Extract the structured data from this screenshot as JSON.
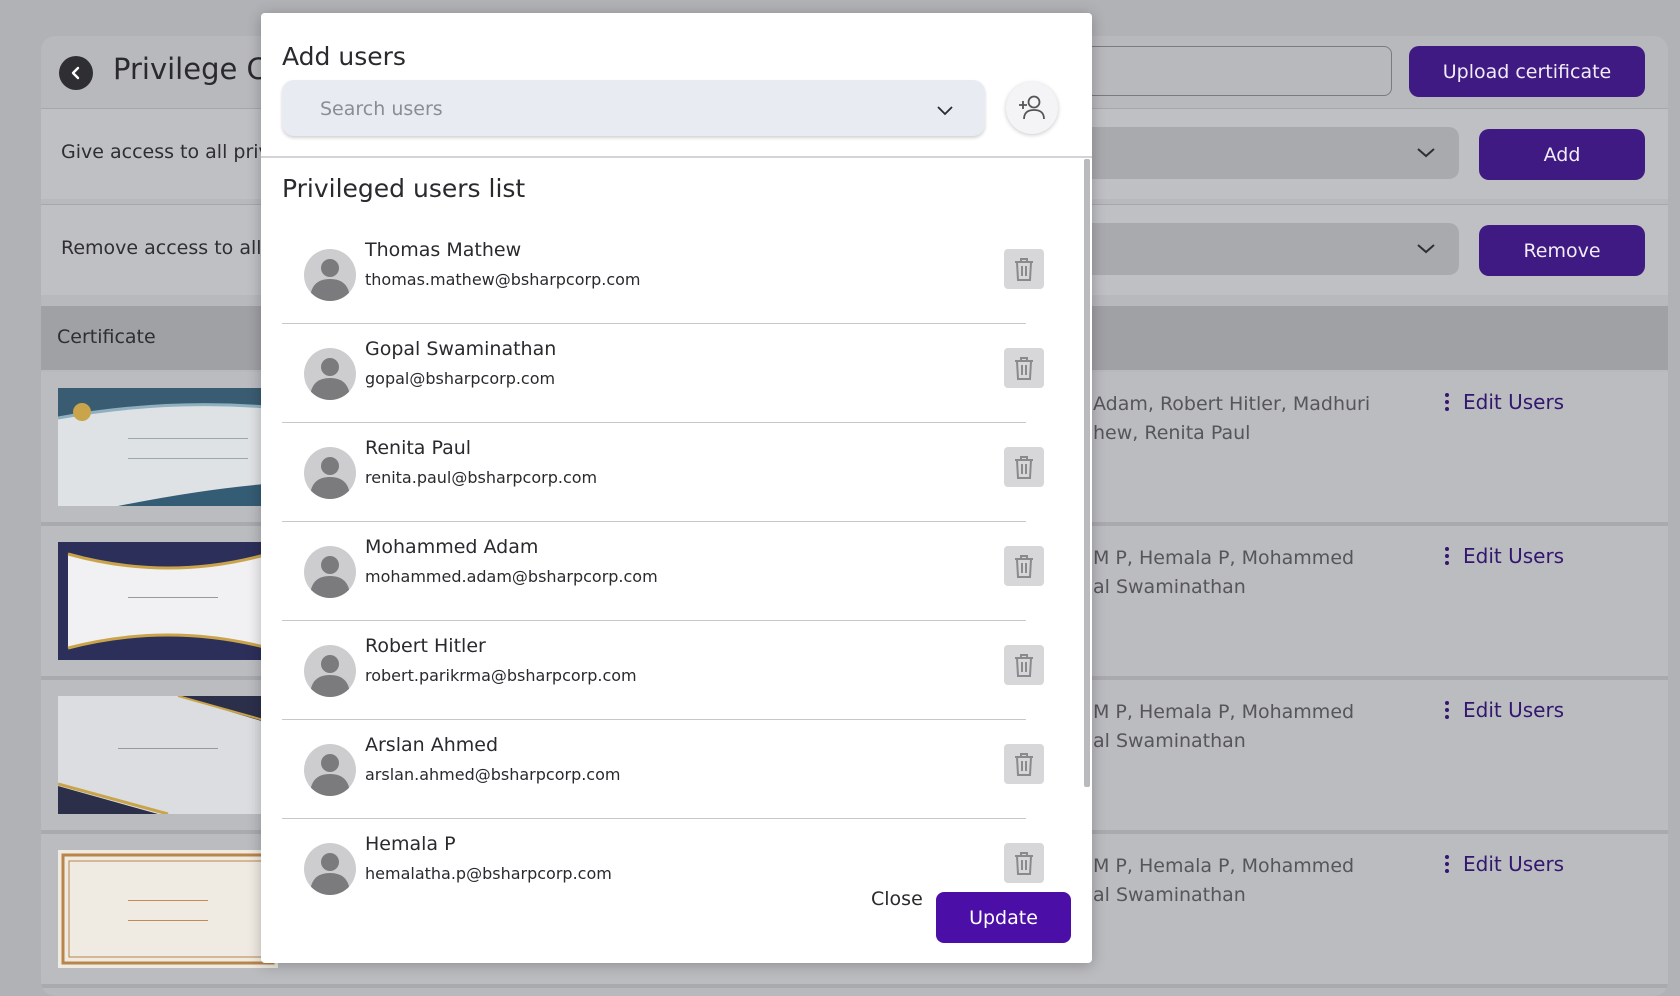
{
  "background": {
    "page_title": "Privilege C",
    "upload_button": "Upload certificate",
    "give_access_label": "Give access to all priv",
    "add_button": "Add",
    "remove_access_label": "Remove access to all",
    "remove_button": "Remove",
    "table_header": "Certificate",
    "rows": [
      {
        "users_line1": "Adam, Robert Hitler, Madhuri",
        "users_line2": "hew, Renita Paul",
        "edit": "Edit Users"
      },
      {
        "users_line1": "M P, Hemala P, Mohammed",
        "users_line2": "al Swaminathan",
        "edit": "Edit Users"
      },
      {
        "users_line1": "M P, Hemala P, Mohammed",
        "users_line2": "al Swaminathan",
        "edit": "Edit Users"
      },
      {
        "users_line1": "M P, Hemala P, Mohammed",
        "users_line2": "al Swaminathan",
        "edit": "Edit Users"
      }
    ]
  },
  "modal": {
    "title": "Add users",
    "search_placeholder": "Search users",
    "search_value": "",
    "list_title": "Privileged users list",
    "users": [
      {
        "name": "Thomas Mathew",
        "email": "thomas.mathew@bsharpcorp.com"
      },
      {
        "name": "Gopal Swaminathan",
        "email": "gopal@bsharpcorp.com"
      },
      {
        "name": "Renita Paul",
        "email": "renita.paul@bsharpcorp.com"
      },
      {
        "name": "Mohammed Adam",
        "email": "mohammed.adam@bsharpcorp.com"
      },
      {
        "name": "Robert Hitler",
        "email": "robert.parikrma@bsharpcorp.com"
      },
      {
        "name": "Arslan Ahmed",
        "email": "arslan.ahmed@bsharpcorp.com"
      },
      {
        "name": "Hemala P",
        "email": "hemalatha.p@bsharpcorp.com"
      }
    ],
    "close_label": "Close",
    "update_label": "Update"
  },
  "colors": {
    "accent": "#4b0fa8",
    "accent_dimmed": "#3f1a82",
    "overlay_bg": "#b1b2b6"
  }
}
